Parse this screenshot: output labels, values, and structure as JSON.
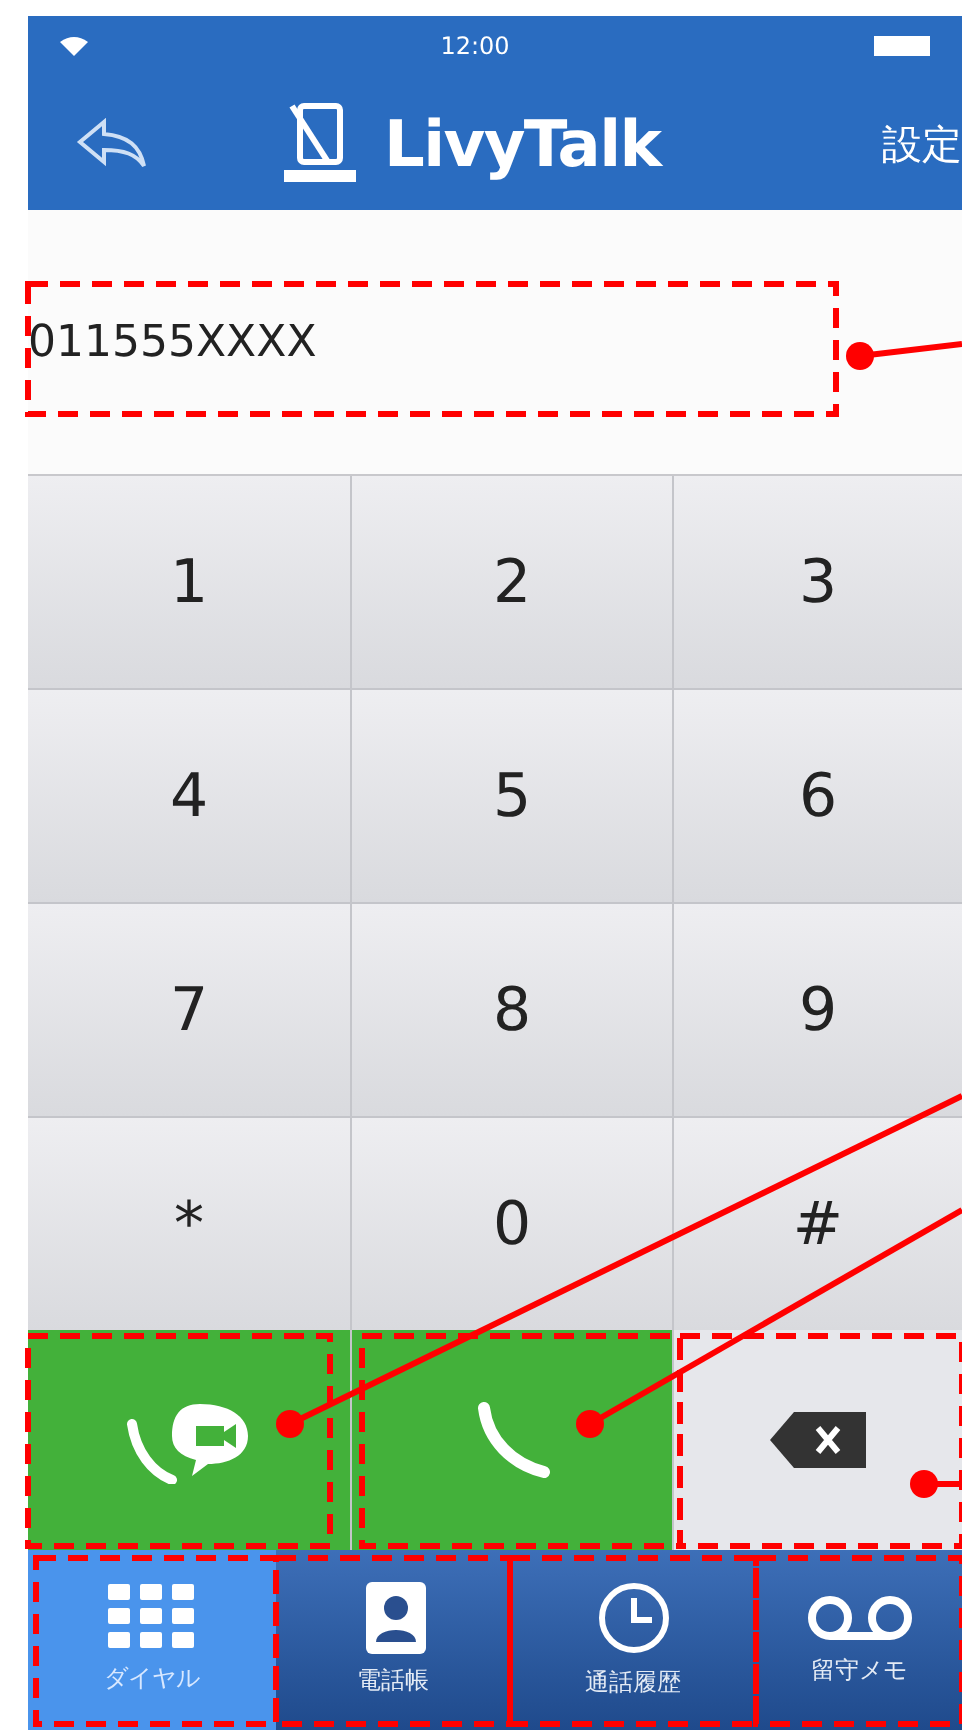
{
  "status_bar": {
    "time": "12:00"
  },
  "nav": {
    "title": "LivyTalk",
    "settings": "設定"
  },
  "number_field": {
    "value": "011555XXXX"
  },
  "keys": [
    "1",
    "2",
    "3",
    "4",
    "5",
    "6",
    "7",
    "8",
    "9",
    "*",
    "0",
    "#"
  ],
  "actions": [
    {
      "kind": "video_call"
    },
    {
      "kind": "call"
    },
    {
      "kind": "delete"
    }
  ],
  "tabs": [
    {
      "label": "ダイヤル",
      "kind": "dial",
      "selected": true
    },
    {
      "label": "電話帳",
      "kind": "contacts",
      "selected": false
    },
    {
      "label": "通話履歴",
      "kind": "history",
      "selected": false
    },
    {
      "label": "留守メモ",
      "kind": "voicemail",
      "selected": false
    }
  ]
}
